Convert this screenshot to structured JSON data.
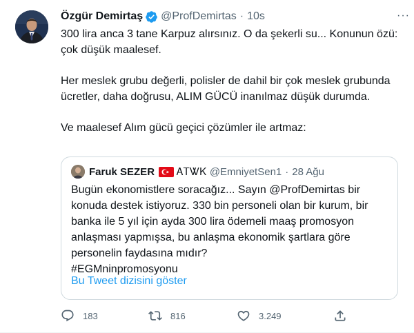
{
  "tweet": {
    "author_name": "Özgür Demirtaş",
    "handle": "@ProfDemirtas",
    "separator": "·",
    "time": "10s",
    "more_label": "···",
    "paragraphs": [
      "300 lira anca 3 tane Karpuz alırsınız. O da şekerli su... Konunun özü: çok düşük maalesef.",
      "Her meslek grubu değerli, polisler de dahil bir çok meslek grubunda ücretler, daha doğrusu, ALIM GÜCÜ inanılmaz düşük durumda.",
      "Ve maalesef Alım gücü geçici çözümler ile artmaz:"
    ]
  },
  "quoted": {
    "author_name": "Faruk SEZER",
    "extra": "ᎪᎢᏔᏦ",
    "handle": "@EmniyetSen1",
    "separator": "·",
    "date": "28 Ağu",
    "text_lines": [
      "Bugün ekonomistlere soracağız... Sayın @ProfDemirtas bir",
      "konuda destek istiyoruz. 330 bin personeli olan bir kurum, bir",
      "banka ile 5 yıl için ayda 300 lira ödemeli maaş promosyon",
      "anlaşması yapmışsa, bu anlaşma ekonomik şartlara göre",
      "personelin faydasına mıdır?",
      "#EGMninpromosyonu"
    ],
    "thread_link": "Bu Tweet dizisini göster"
  },
  "actions": {
    "replies": "183",
    "retweets": "816",
    "likes": "3.249",
    "share_label": ""
  },
  "colors": {
    "accent": "#1d9bf0",
    "muted": "#536471",
    "border": "#cfd9de",
    "text": "#0f1419"
  },
  "icons": {
    "verified": "verified-badge-icon",
    "flag": "turkey-flag-icon",
    "reply": "reply-icon",
    "retweet": "retweet-icon",
    "like": "heart-icon",
    "share": "share-icon"
  }
}
